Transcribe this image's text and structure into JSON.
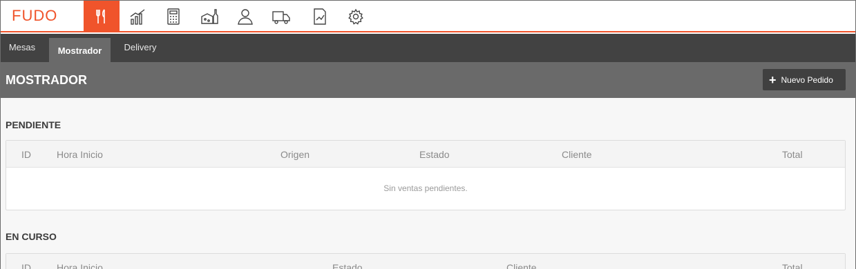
{
  "app": {
    "logo_text": "FUDO",
    "accent": "#f0542b"
  },
  "nav": {
    "icons": [
      {
        "name": "cutlery-icon",
        "active": true
      },
      {
        "name": "bar-chart-icon",
        "active": false
      },
      {
        "name": "calculator-icon",
        "active": false
      },
      {
        "name": "inventory-icon",
        "active": false
      },
      {
        "name": "user-icon",
        "active": false
      },
      {
        "name": "delivery-truck-icon",
        "active": false
      },
      {
        "name": "report-icon",
        "active": false
      },
      {
        "name": "gear-icon",
        "active": false
      }
    ]
  },
  "tabs": {
    "mesas": "Mesas",
    "mostrador": "Mostrador",
    "delivery": "Delivery"
  },
  "header": {
    "title": "MOSTRADOR",
    "new_order_plus": "+",
    "new_order_label": "Nuevo Pedido"
  },
  "pendiente": {
    "title": "PENDIENTE",
    "columns": [
      "ID",
      "Hora Inicio",
      "Origen",
      "Estado",
      "Cliente",
      "Total"
    ],
    "empty_message": "Sin ventas pendientes."
  },
  "en_curso": {
    "title": "EN CURSO",
    "columns": [
      "ID",
      "Hora Inicio",
      "Estado",
      "Cliente",
      "Total"
    ]
  }
}
